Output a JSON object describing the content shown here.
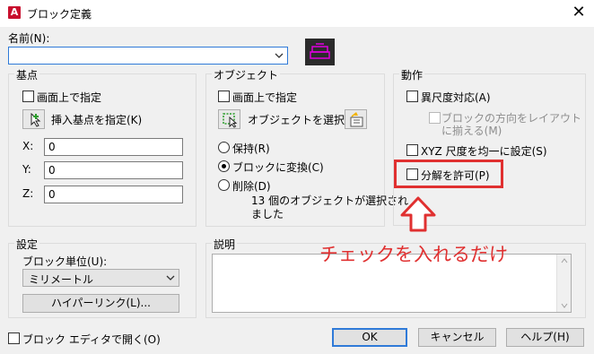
{
  "window": {
    "title": "ブロック定義",
    "app_icon_letter": "A",
    "close_glyph": "✕"
  },
  "name_field": {
    "label": "名前(N):",
    "value": ""
  },
  "basepoint": {
    "title": "基点",
    "on_screen_label": "画面上で指定",
    "pick_label": "挿入基点を指定(K)",
    "x_label": "X:",
    "x_value": "0",
    "y_label": "Y:",
    "y_value": "0",
    "z_label": "Z:",
    "z_value": "0"
  },
  "objects": {
    "title": "オブジェクト",
    "on_screen_label": "画面上で指定",
    "select_label": "オブジェクトを選択(T)",
    "retain_label": "保持(R)",
    "convert_label": "ブロックに変換(C)",
    "delete_label": "削除(D)",
    "selected_count_line1": "13 個のオブジェクトが選択され",
    "selected_count_line2": "ました"
  },
  "behavior": {
    "title": "動作",
    "annotative_label": "異尺度対応(A)",
    "match_orientation_line1": "ブロックの方向をレイアウト",
    "match_orientation_line2": "に揃える(M)",
    "uniform_scale_label": "XYZ 尺度を均一に設定(S)",
    "allow_explode_label": "分解を許可(P)"
  },
  "settings": {
    "title": "設定",
    "unit_label": "ブロック単位(U):",
    "unit_value": "ミリメートル",
    "hyperlink_label": "ハイパーリンク(L)..."
  },
  "description": {
    "title": "説明",
    "value": ""
  },
  "annotation": {
    "text": "チェックを入れるだけ",
    "color": "#e03030"
  },
  "footer": {
    "open_in_editor_label": "ブロック エディタで開く(O)",
    "ok_label": "OK",
    "cancel_label": "キャンセル",
    "help_label": "ヘルプ(H)"
  },
  "colors": {
    "accent": "#2f7ad8",
    "highlight_box": "#e03030",
    "preview_bg": "#2b2b2b",
    "preview_fg": "#e000e0"
  }
}
